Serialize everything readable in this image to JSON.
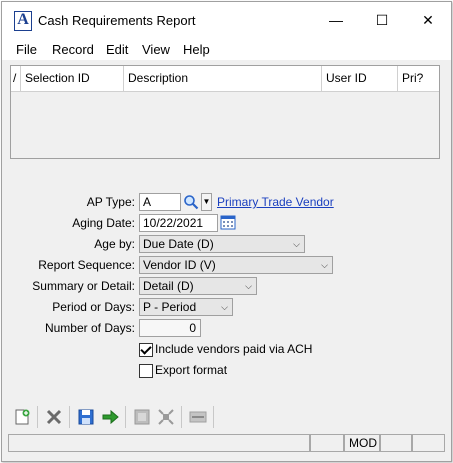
{
  "window": {
    "title": "Cash Requirements Report",
    "minimize": "—",
    "maximize": "☐",
    "close": "✕"
  },
  "menu": [
    "File",
    "Record",
    "Edit",
    "View",
    "Help"
  ],
  "grid": {
    "columns": [
      "Selection ID",
      "Description",
      "User ID",
      "Pri?"
    ],
    "rows": []
  },
  "form": {
    "ap_type": {
      "label": "AP Type:",
      "value": "A",
      "link": "Primary Trade Vendor"
    },
    "aging_date": {
      "label": "Aging Date:",
      "value": "10/22/2021"
    },
    "age_by": {
      "label": "Age by:",
      "value": "Due Date (D)"
    },
    "report_sequence": {
      "label": "Report Sequence:",
      "value": "Vendor ID (V)"
    },
    "summary_detail": {
      "label": "Summary or Detail:",
      "value": "Detail (D)"
    },
    "period_days": {
      "label": "Period or Days:",
      "value": "P - Period"
    },
    "number_days": {
      "label": "Number of Days:",
      "value": "0"
    },
    "include_ach": {
      "label": "Include vendors paid via ACH",
      "checked": true
    },
    "export_format": {
      "label": "Export format",
      "checked": false
    }
  },
  "toolbar": [
    "new-icon",
    "delete-icon",
    "save-icon",
    "process-icon",
    "print-icon",
    "expand-icon",
    "field-icon"
  ],
  "status": {
    "mod": "MOD"
  }
}
